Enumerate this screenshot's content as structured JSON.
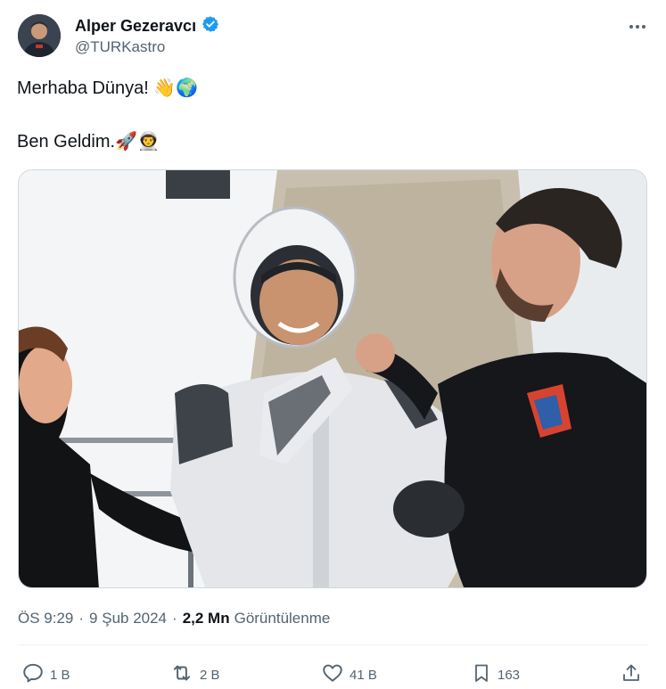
{
  "author": {
    "name": "Alper Gezeravcı",
    "handle": "@TURKastro",
    "verified": true,
    "verified_color": "#1d9bf0"
  },
  "tweet": {
    "line1": "Merhaba Dünya! 👋🌍",
    "line2": "Ben Geldim.🚀👨‍🚀"
  },
  "meta": {
    "time": "ÖS 9:29",
    "separator": "·",
    "date": "9 Şub 2024",
    "views_count": "2,2 Mn",
    "views_label": "Görüntülenme"
  },
  "actions": {
    "replies": "1 B",
    "reposts": "2 B",
    "likes": "41 B",
    "bookmarks": "163"
  },
  "colors": {
    "text": "#0f1419",
    "secondary": "#536471",
    "accent": "#1d9bf0"
  }
}
